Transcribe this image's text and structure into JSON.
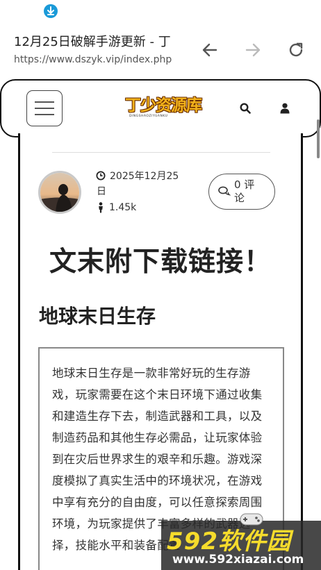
{
  "browser": {
    "page_title": "12月25日破解手游更新 - 丁",
    "url": "https://www.dszyk.vip/index.php",
    "accent_color": "#1a9ad8"
  },
  "header": {
    "logo_text": "丁少资源库",
    "logo_sub": "DINGSHAOZIYUANKU",
    "icons": [
      "menu-icon",
      "search-icon",
      "user-icon"
    ]
  },
  "article": {
    "date": "2025年12月25日",
    "views": "1.45k",
    "comments": "0 评论",
    "headline": "文末附下载链接！",
    "subhead": "地球末日生存",
    "body": "地球末日生存是一款非常好玩的生存游戏，玩家需要在这个末日环境下通过收集和建造生存下去，制造武器和工具，以及制造药品和其他生存必需品，让玩家体验到在灾后世界求生的艰辛和乐趣。游戏深度模拟了真实生活中的环境状况，在游戏中享有充分的自由度，可以任意探索周围环境，为玩家提供了丰富多样的武器选择，技能水平和装备配置"
  },
  "watermark": {
    "brand": "592软件园",
    "url": "www.592xiazai.com",
    "colors": {
      "brand": "#f6dc2c",
      "url": "#ffffff"
    }
  }
}
